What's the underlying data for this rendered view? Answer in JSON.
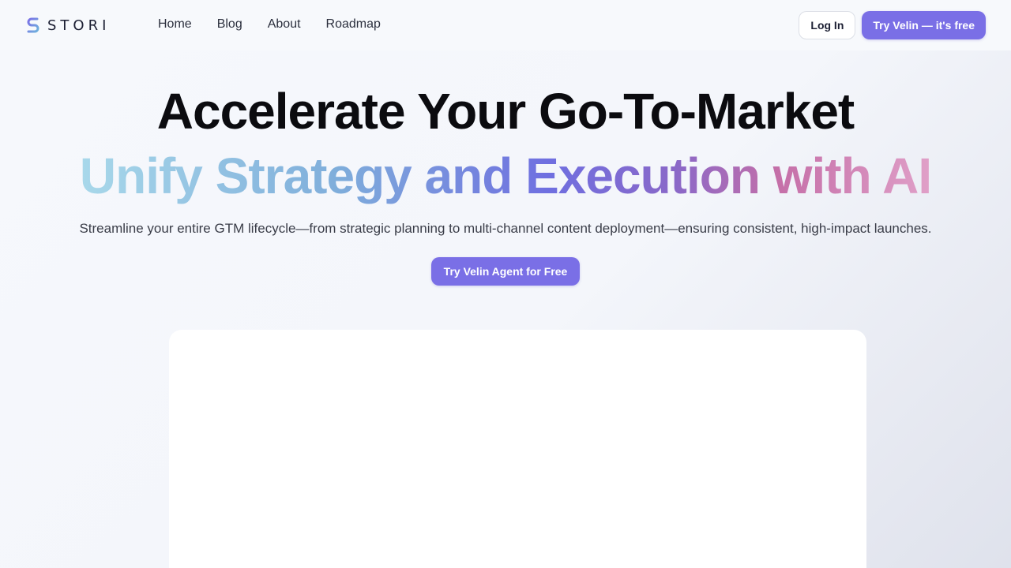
{
  "brand": {
    "name": "STORI",
    "logo_icon": "s-logo-icon",
    "accent_color": "#7a6fe6"
  },
  "nav": {
    "links": [
      "Home",
      "Blog",
      "About",
      "Roadmap"
    ],
    "login_label": "Log In",
    "cta_label": "Try Velin — it's free"
  },
  "hero": {
    "title": "Accelerate Your Go-To-Market",
    "subtitle": "Unify Strategy and Execution with AI",
    "description": "Streamline your entire GTM lifecycle—from strategic planning to multi-channel content deployment—ensuring consistent, high-impact launches.",
    "cta_label": "Try Velin Agent for Free"
  }
}
